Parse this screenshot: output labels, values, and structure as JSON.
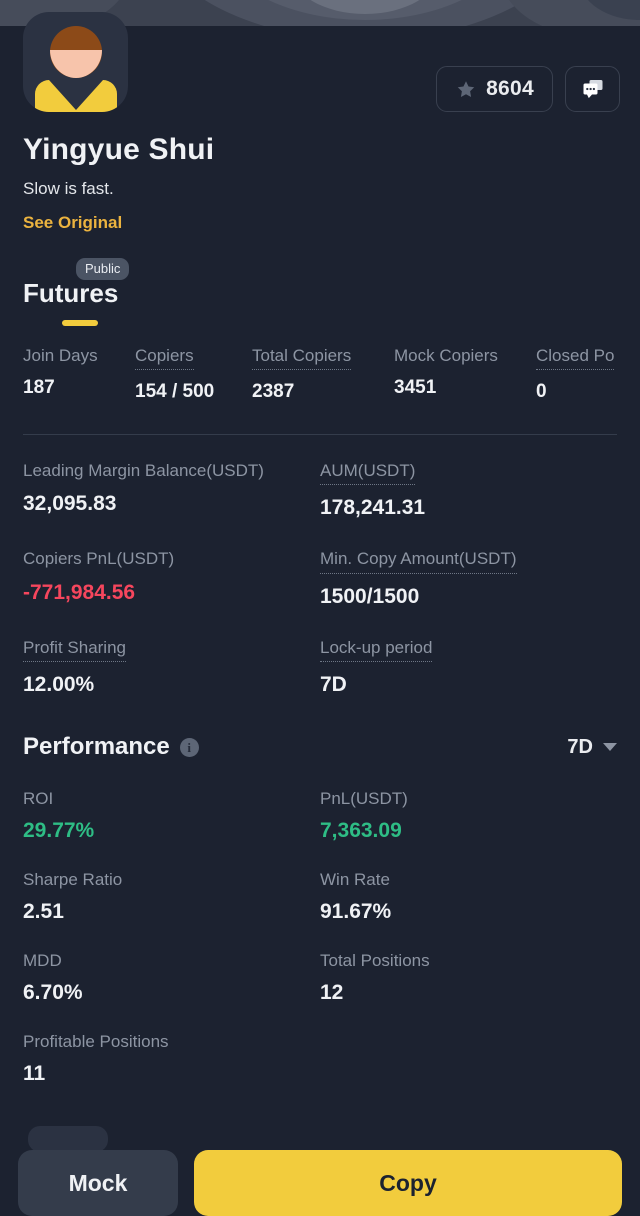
{
  "colors": {
    "background": "#1c2230",
    "accent_yellow": "#f2cc3d",
    "positive_green": "#2ebd85",
    "negative_red": "#f6465d",
    "muted_text": "#8d95a3"
  },
  "header": {
    "avatar_icon": "user-avatar",
    "display_name": "Yingyue Shui",
    "tagline": "Slow is fast.",
    "see_original_label": "See Original",
    "favorite": {
      "icon": "star-icon",
      "count": "8604"
    },
    "chat": {
      "icon": "chat-bubble-icon"
    }
  },
  "tabs": {
    "active": "Futures",
    "badge": "Public"
  },
  "metrics_row": [
    {
      "label": "Join Days",
      "value": "187",
      "dotted": false
    },
    {
      "label": "Copiers",
      "value": "154 / 500",
      "dotted": true
    },
    {
      "label": "Total Copiers",
      "value": "2387",
      "dotted": true
    },
    {
      "label": "Mock Copiers",
      "value": "3451",
      "dotted": false
    },
    {
      "label": "Closed Po",
      "value": "0",
      "dotted": true
    }
  ],
  "details": [
    [
      {
        "label": "Leading Margin Balance(USDT)",
        "value": "32,095.83",
        "dotted": false,
        "tone": ""
      },
      {
        "label": "AUM(USDT)",
        "value": "178,241.31",
        "dotted": true,
        "tone": ""
      }
    ],
    [
      {
        "label": "Copiers PnL(USDT)",
        "value": "-771,984.56",
        "dotted": false,
        "tone": "neg"
      },
      {
        "label": "Min. Copy Amount(USDT)",
        "value": "1500/1500",
        "dotted": true,
        "tone": ""
      }
    ],
    [
      {
        "label": "Profit Sharing",
        "value": "12.00%",
        "dotted": true,
        "tone": ""
      },
      {
        "label": "Lock-up period",
        "value": "7D",
        "dotted": true,
        "tone": ""
      }
    ]
  ],
  "performance": {
    "title": "Performance",
    "info_icon": "info-icon",
    "range_label": "7D",
    "range_caret_icon": "chevron-down-icon",
    "rows": [
      [
        {
          "label": "ROI",
          "value": "29.77%",
          "tone": "pos"
        },
        {
          "label": "PnL(USDT)",
          "value": "7,363.09",
          "tone": "pos"
        }
      ],
      [
        {
          "label": "Sharpe Ratio",
          "value": "2.51",
          "tone": ""
        },
        {
          "label": "Win Rate",
          "value": "91.67%",
          "tone": ""
        }
      ],
      [
        {
          "label": "MDD",
          "value": "6.70%",
          "tone": ""
        },
        {
          "label": "Total Positions",
          "value": "12",
          "tone": ""
        }
      ],
      [
        {
          "label": "Profitable Positions",
          "value": "11",
          "tone": ""
        },
        {
          "label": "",
          "value": "",
          "tone": ""
        }
      ]
    ]
  },
  "bottom_bar": {
    "mock_label": "Mock",
    "copy_label": "Copy"
  }
}
